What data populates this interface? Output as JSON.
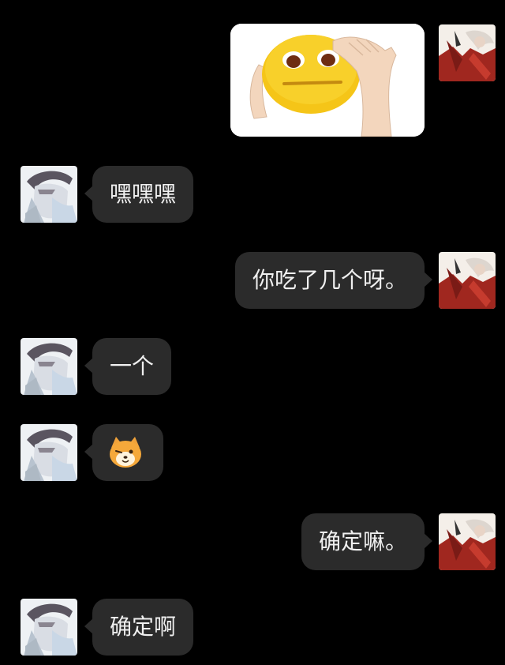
{
  "messages": [
    {
      "side": "right",
      "type": "sticker",
      "sticker": "yellow-face-salute-sticker"
    },
    {
      "side": "left",
      "type": "text",
      "text": "嘿嘿嘿"
    },
    {
      "side": "right",
      "type": "text",
      "text": "你吃了几个呀。"
    },
    {
      "side": "left",
      "type": "text",
      "text": "一个"
    },
    {
      "side": "left",
      "type": "emoji",
      "emoji": "shiba-dog-face-emoji"
    },
    {
      "side": "right",
      "type": "text",
      "text": "确定嘛。"
    },
    {
      "side": "left",
      "type": "text",
      "text": "确定啊"
    }
  ],
  "colors": {
    "background": "#000000",
    "bubble": "#2b2b2b",
    "text": "#f0f0f0"
  }
}
